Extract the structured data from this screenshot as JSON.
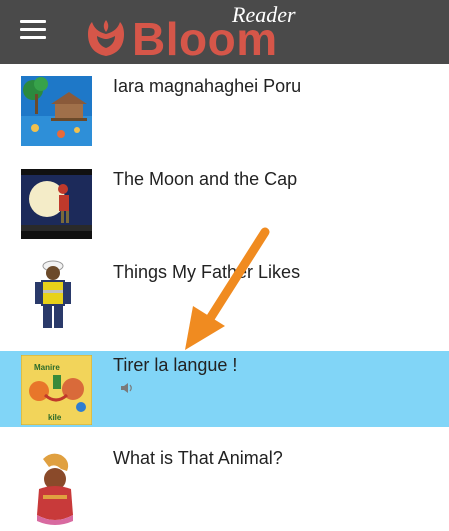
{
  "app": {
    "name": "Bloom",
    "subtitle": "Reader",
    "brand_color": "#d65649",
    "header_color": "#4a4a4a"
  },
  "header": {
    "menu_icon": "hamburger-menu-icon"
  },
  "books": [
    {
      "title": "Iara magnahaghei Poru",
      "selected": false
    },
    {
      "title": "The Moon and the Cap",
      "selected": false
    },
    {
      "title": "Things My Father Likes",
      "selected": false
    },
    {
      "title": "Tirer la langue !",
      "selected": true,
      "has_audio": true,
      "cover_text_top": "Manire",
      "cover_text_bottom": "kile"
    },
    {
      "title": "What is That Animal?",
      "selected": false
    }
  ],
  "selection_color": "#81d5f7",
  "annotation": {
    "arrow_color": "#f08b20"
  }
}
